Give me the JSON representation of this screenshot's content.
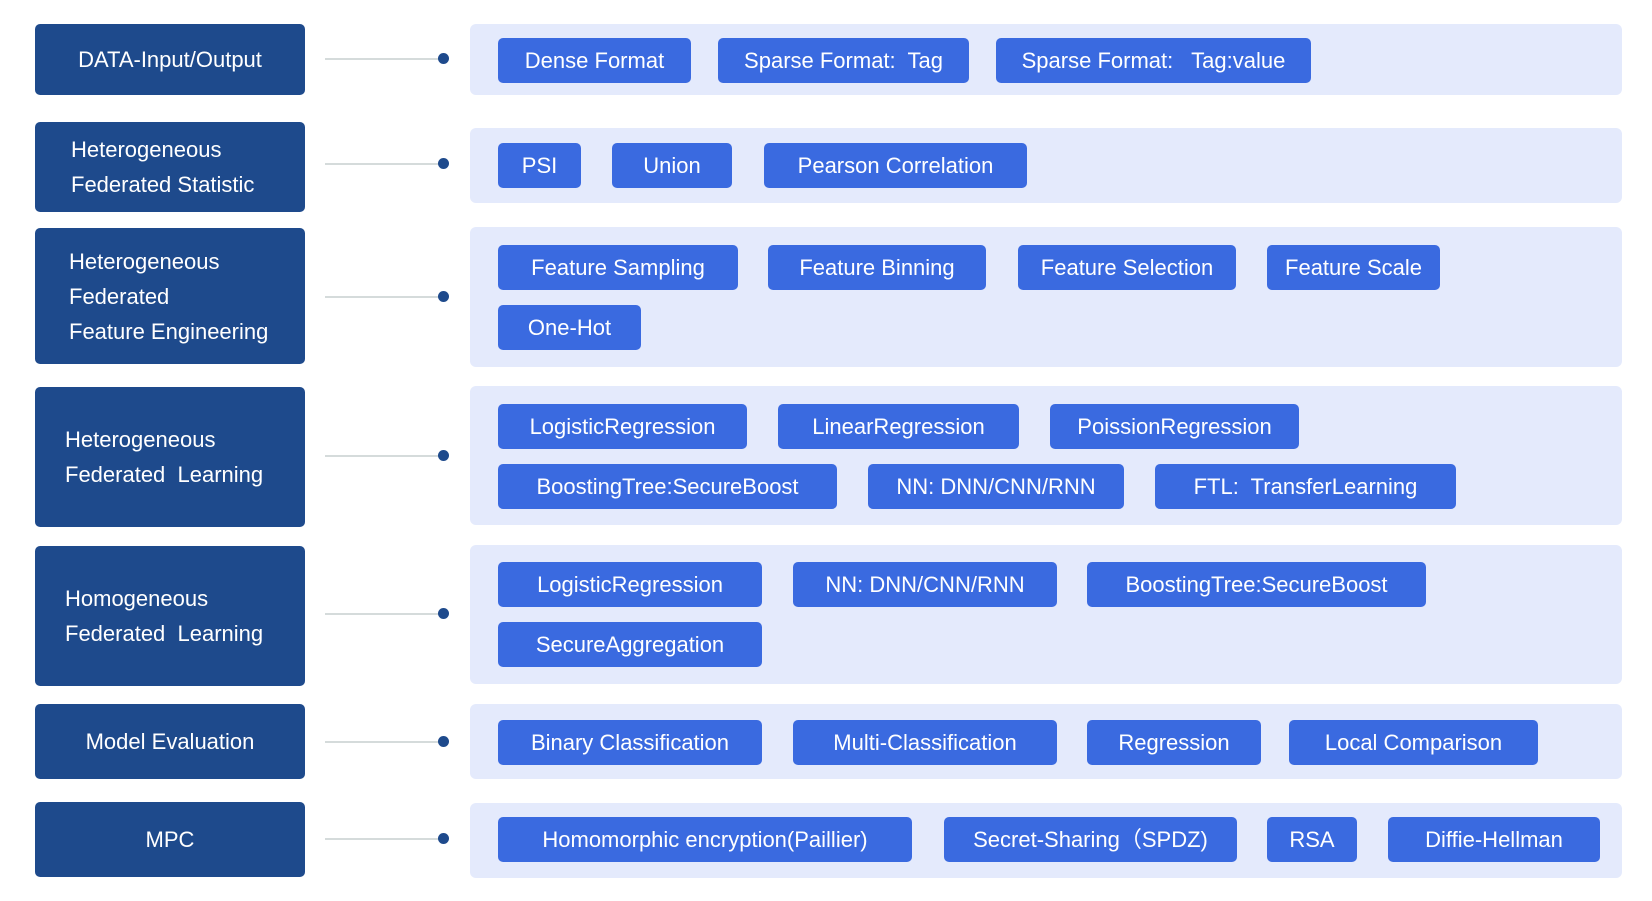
{
  "colors": {
    "label_bg": "#1E4A8C",
    "panel_bg": "#E4EAFC",
    "chip_bg": "#3A6AE0",
    "connector": "#D5DBDB",
    "text": "#FFFFFF"
  },
  "rows": [
    {
      "label": [
        "DATA-Input/Output"
      ],
      "items": [
        "Dense Format",
        "Sparse Format:  Tag",
        "Sparse Format:   Tag:value"
      ]
    },
    {
      "label": [
        "Heterogeneous",
        "Federated Statistic"
      ],
      "items": [
        "PSI",
        "Union",
        "Pearson Correlation"
      ]
    },
    {
      "label": [
        "Heterogeneous",
        "Federated",
        "Feature Engineering"
      ],
      "items": [
        "Feature Sampling",
        "Feature Binning",
        "Feature Selection",
        "Feature Scale",
        "One-Hot"
      ]
    },
    {
      "label": [
        "Heterogeneous",
        "Federated  Learning"
      ],
      "items": [
        "LogisticRegression",
        "LinearRegression",
        "PoissionRegression",
        "BoostingTree:SecureBoost",
        "NN: DNN/CNN/RNN",
        "FTL:  TransferLearning"
      ]
    },
    {
      "label": [
        "Homogeneous",
        "Federated  Learning"
      ],
      "items": [
        "LogisticRegression",
        "NN: DNN/CNN/RNN",
        "BoostingTree:SecureBoost",
        "SecureAggregation"
      ]
    },
    {
      "label": [
        "Model Evaluation"
      ],
      "items": [
        "Binary Classification",
        "Multi-Classification",
        "Regression",
        "Local Comparison"
      ]
    },
    {
      "label": [
        "MPC"
      ],
      "items": [
        "Homomorphic encryption(Paillier)",
        "Secret-Sharing（SPDZ)",
        "RSA",
        "Diffie-Hellman"
      ]
    }
  ]
}
